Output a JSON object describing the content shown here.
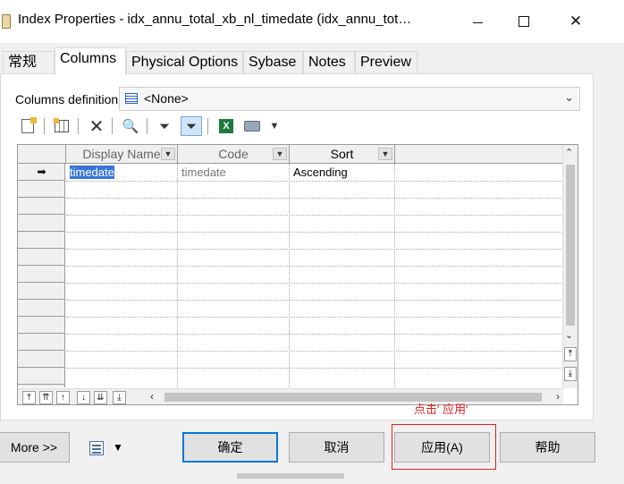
{
  "window": {
    "title": "Index Properties - idx_annu_total_xb_nl_timedate (idx_annu_tot…",
    "minimize_glyph": "—",
    "close_glyph": "✕"
  },
  "tabs": [
    {
      "label": "常规",
      "active": false
    },
    {
      "label": "Columns",
      "active": true
    },
    {
      "label": "Physical Options",
      "active": false
    },
    {
      "label": "Sybase",
      "active": false
    },
    {
      "label": "Notes",
      "active": false
    },
    {
      "label": "Preview",
      "active": false
    }
  ],
  "column_definition": {
    "label": "Columns definition:",
    "value": "<None>"
  },
  "toolbar": {
    "icons": [
      "properties-icon",
      "add-columns-icon",
      "delete-icon",
      "find-icon",
      "filter-icon",
      "filter-active-icon",
      "excel-icon",
      "print-icon",
      "dropdown-arrow-icon"
    ]
  },
  "grid": {
    "columns": [
      "Display Name",
      "Code",
      "Sort"
    ],
    "rows": [
      {
        "marker": "➡",
        "display_name": "timedate",
        "code": "timedate",
        "sort": "Ascending"
      }
    ],
    "move_buttons": [
      "⤒",
      "⇈",
      "↑",
      "↓",
      "⇊",
      "⤓"
    ]
  },
  "annotation": {
    "text": "点击' 应用'",
    "color": "#e02020"
  },
  "buttons": {
    "more": "More >>",
    "ok": "确定",
    "cancel": "取消",
    "apply": "应用(A)",
    "help": "帮助"
  },
  "colors": {
    "accent": "#0078d7",
    "selection": "#3875d6"
  }
}
